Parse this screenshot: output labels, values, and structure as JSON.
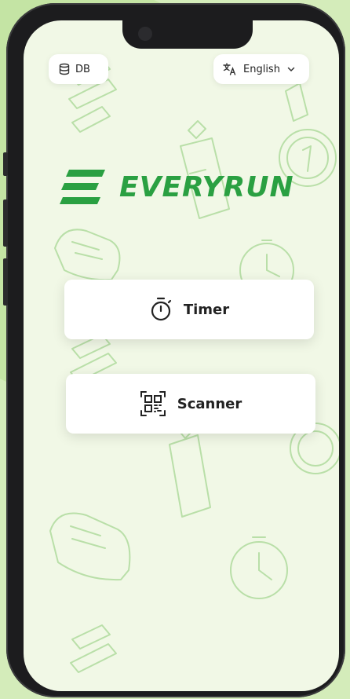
{
  "header": {
    "db_label": "DB",
    "db_icon": "database-icon",
    "language_label": "English",
    "language_icon": "translate-icon",
    "language_chevron_icon": "chevron-down-icon"
  },
  "brand": {
    "name": "EVERYRUN",
    "color": "#2aa042"
  },
  "actions": [
    {
      "label": "Timer",
      "icon": "stopwatch-icon"
    },
    {
      "label": "Scanner",
      "icon": "qr-scan-icon"
    }
  ],
  "theme": {
    "background": "#f1f8e6",
    "doodle_color": "#b9dfa8"
  }
}
